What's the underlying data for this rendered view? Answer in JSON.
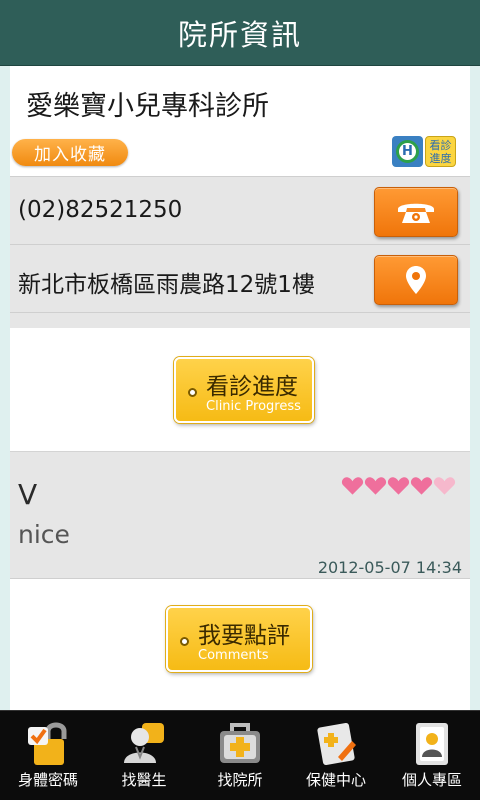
{
  "header": {
    "title": "院所資訊"
  },
  "clinic": {
    "name": "愛樂寶小兒專科診所",
    "favorite_label": "加入收藏",
    "badge_progress_label": "看診進度",
    "phone": "(02)82521250",
    "address": "新北市板橋區雨農路12號1樓"
  },
  "progress_button": {
    "zh": "看診進度",
    "en": "Clinic Progress"
  },
  "review": {
    "reviewer": "V",
    "text": "nice",
    "date": "2012-05-07 14:34",
    "rating": 4.5
  },
  "comment_button": {
    "zh": "我要點評",
    "en": "Comments"
  },
  "bottom_nav": [
    {
      "label": "身體密碼",
      "icon": "lock-icon"
    },
    {
      "label": "找醫生",
      "icon": "doctor-icon"
    },
    {
      "label": "找院所",
      "icon": "medical-kit-icon"
    },
    {
      "label": "保健中心",
      "icon": "health-note-icon"
    },
    {
      "label": "個人專區",
      "icon": "profile-icon"
    }
  ],
  "colors": {
    "header_bg": "#2f5e58",
    "accent_orange": "#f0750a",
    "button_yellow": "#f6bb15",
    "page_bg": "#dff0ef"
  }
}
